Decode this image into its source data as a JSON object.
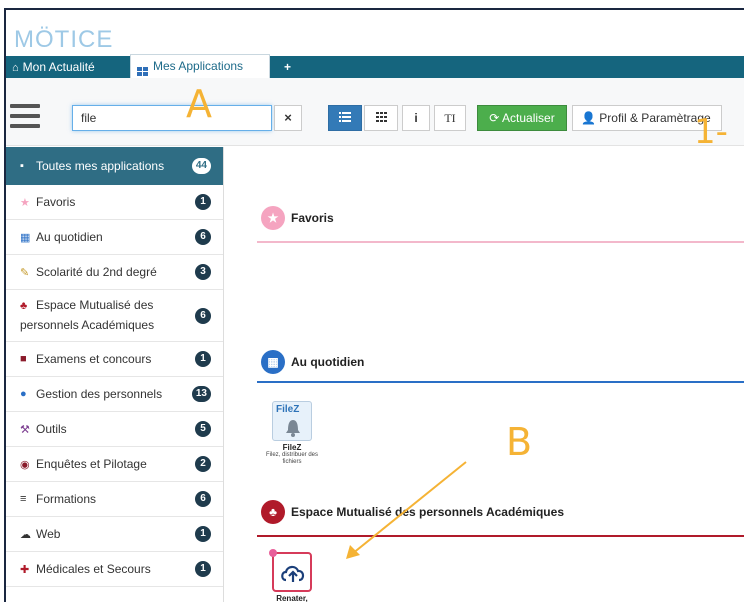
{
  "app": {
    "logo_text": "MÖTICE"
  },
  "tabs": [
    {
      "label": "Mon Actualité",
      "icon": "home-icon"
    },
    {
      "label": "Mes Applications",
      "icon": "grid-icon"
    },
    {
      "label": "+"
    }
  ],
  "toolbar": {
    "search_value": "file",
    "clear_label": "×",
    "view_list_icon": "list-icon",
    "view_grid_icon": "grid-icon",
    "info_label": "i",
    "text_label": "TI",
    "refresh_label": "Actualiser",
    "profile_label": "Profil & Paramètrage"
  },
  "sidebar": {
    "items": [
      {
        "label": "Toutes mes applications",
        "count": "44",
        "icon": "folder-icon"
      },
      {
        "label": "Favoris",
        "count": "1",
        "icon": "star-icon"
      },
      {
        "label": "Au quotidien",
        "count": "6",
        "icon": "calendar-icon"
      },
      {
        "label": "Scolarité du 2nd degré",
        "count": "3",
        "icon": "edit-icon"
      },
      {
        "label": "Espace Mutualisé des personnels Académiques",
        "count": "6",
        "icon": "puzzle-icon"
      },
      {
        "label": "Examens et concours",
        "count": "1",
        "icon": "briefcase-icon"
      },
      {
        "label": "Gestion des personnels",
        "count": "13",
        "icon": "user-icon"
      },
      {
        "label": "Outils",
        "count": "5",
        "icon": "wrench-icon"
      },
      {
        "label": "Enquêtes et Pilotage",
        "count": "2",
        "icon": "gauge-icon"
      },
      {
        "label": "Formations",
        "count": "6",
        "icon": "graduation-icon"
      },
      {
        "label": "Web",
        "count": "1",
        "icon": "cloud-icon"
      },
      {
        "label": "Médicales et Secours",
        "count": "1",
        "icon": "medkit-icon"
      }
    ]
  },
  "main": {
    "sections": [
      {
        "title": "Favoris",
        "icon": "star-icon",
        "color": "#f5a4c0"
      },
      {
        "title": "Au quotidien",
        "icon": "calendar-icon",
        "color": "#2a6fc6"
      },
      {
        "title": "Espace Mutualisé des personnels Académiques",
        "icon": "puzzle-icon",
        "color": "#b01a2a"
      }
    ],
    "apps": [
      {
        "name": "FileZ",
        "desc": "Filez, distribuer des fichiers",
        "icon_text": "FileZ"
      },
      {
        "name": "Renater, Filesender"
      }
    ]
  },
  "annotations": {
    "a": "A",
    "b": "B",
    "one": "1-"
  },
  "colors": {
    "tabbar": "#15657e",
    "active_sidebar": "#2f6d84",
    "refresh": "#4cae4c",
    "annotation": "#f5b335"
  }
}
